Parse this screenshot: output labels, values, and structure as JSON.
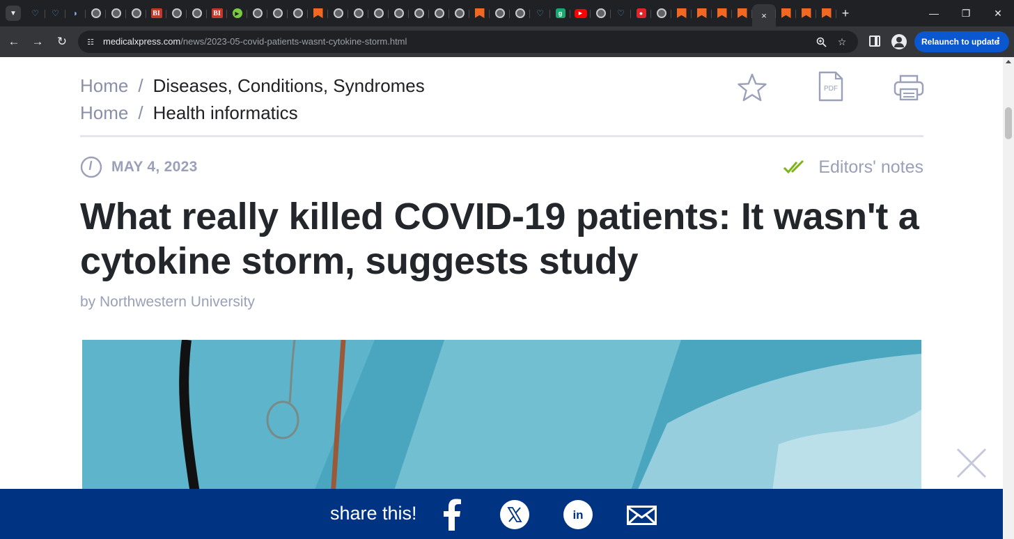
{
  "browser": {
    "tab_favicons": [
      "chrome-tab-search",
      "heart",
      "heart",
      "play-dark",
      "globe",
      "globe",
      "globe",
      "bi",
      "globe",
      "globe",
      "bi",
      "green-play",
      "globe",
      "globe",
      "globe",
      "bookmark-orange",
      "globe",
      "globe",
      "globe",
      "globe",
      "globe",
      "globe",
      "globe",
      "bookmark-orange",
      "globe",
      "globe",
      "heart",
      "g",
      "youtube",
      "globe",
      "heart",
      "red-mic",
      "globe",
      "bookmark-orange",
      "bookmark-orange",
      "bookmark-orange",
      "bookmark-orange",
      "active",
      "bookmark-orange",
      "bookmark-orange",
      "bookmark-orange"
    ],
    "tab_texts": {
      "bi": "BI",
      "g": "g",
      "youtube": "▶"
    },
    "active_tab_close": "×",
    "new_tab": "+",
    "url_domain": "medicalxpress.com",
    "url_path": "/news/2023-05-covid-patients-wasnt-cytokine-storm.html",
    "relaunch_label": "Relaunch to update",
    "relaunch_menu": "⋮"
  },
  "breadcrumbs": [
    {
      "home": "Home",
      "separator": "/",
      "category": "Diseases, Conditions, Syndromes"
    },
    {
      "home": "Home",
      "separator": "/",
      "category": "Health informatics"
    }
  ],
  "article": {
    "date": "MAY 4, 2023",
    "editors_notes": "Editors' notes",
    "headline_line1": "What really killed COVID-19 patients: It wasn't a",
    "headline_line2": "cytokine storm, suggests study",
    "byline": "by Northwestern University",
    "pdf_label": "PDF"
  },
  "share": {
    "label": "share this!",
    "facebook_glyph": "f",
    "linkedin_glyph": "in"
  },
  "colors": {
    "accent_check": "#7cb518",
    "share_bar": "#003482",
    "relaunch": "#0b57d0",
    "muted": "#9aa0b8"
  }
}
